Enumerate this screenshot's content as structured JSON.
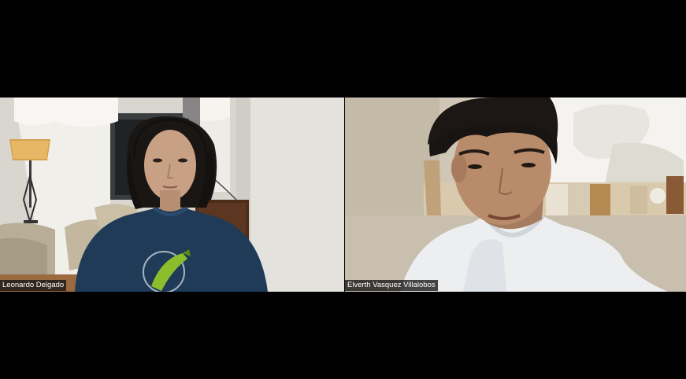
{
  "meeting": {
    "layout": "gallery-view",
    "background_color": "#000000",
    "participants": [
      {
        "name": "Leonardo Delgado",
        "video_on": true,
        "scene": "living-room-with-lamp-and-curtains",
        "shirt_color": "#1f3b58"
      },
      {
        "name": "Elverth Vasquez Villalobos",
        "video_on": true,
        "scene": "room-with-mirror-and-white-hoodie",
        "shirt_color": "#eceef0"
      }
    ]
  }
}
